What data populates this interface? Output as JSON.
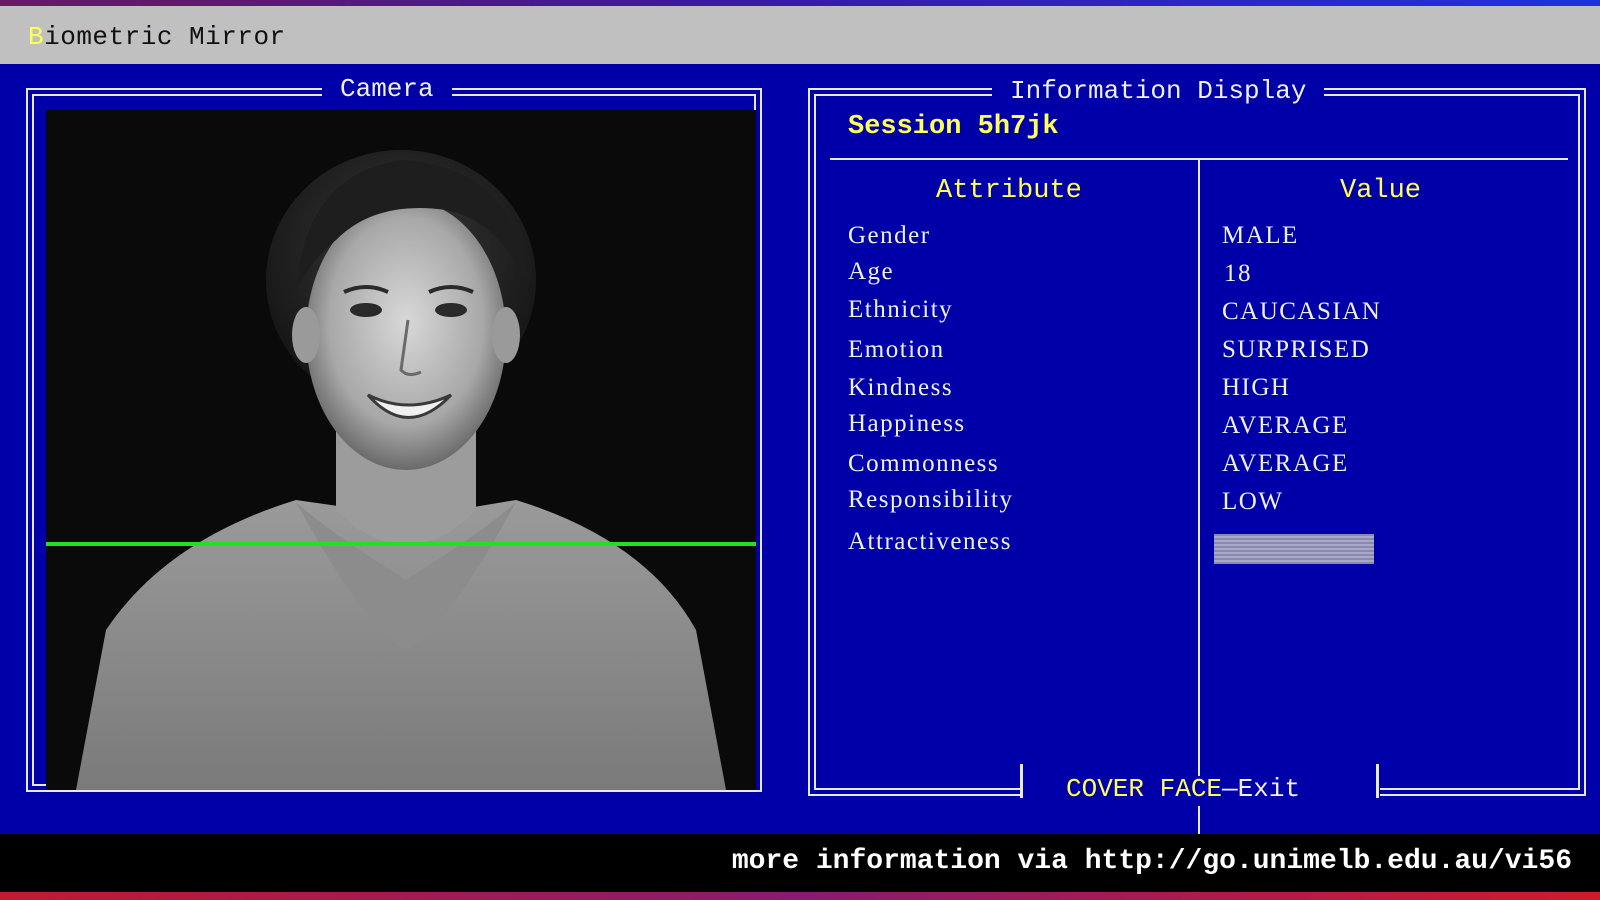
{
  "app": {
    "title_hotkey": "B",
    "title_rest": "iometric Mirror"
  },
  "camera": {
    "panel_title": "Camera"
  },
  "info": {
    "panel_title": "Information Display",
    "session": "Session 5h7jk",
    "columns": {
      "attribute": "Attribute",
      "value": "Value"
    },
    "rows": [
      {
        "attribute": "Gender",
        "value": "MALE"
      },
      {
        "attribute": "Age",
        "value": "18"
      },
      {
        "attribute": "Ethnicity",
        "value": "CAUCASIAN"
      },
      {
        "attribute": "Emotion",
        "value": "SURPRISED"
      },
      {
        "attribute": "Kindness",
        "value": "HIGH"
      },
      {
        "attribute": "Happiness",
        "value": "AVERAGE"
      },
      {
        "attribute": "Commonness",
        "value": "AVERAGE"
      },
      {
        "attribute": "Responsibility",
        "value": "LOW"
      },
      {
        "attribute": "Attractiveness",
        "value": ""
      }
    ],
    "exit_key": "COVER FACE",
    "exit_label": "—Exit"
  },
  "footer": {
    "message": "more information via http://go.unimelb.edu.au/vi56"
  },
  "colors": {
    "background": "#0000a8",
    "highlight": "#ffff55",
    "text": "#f0f0f0",
    "scanline": "#22e022"
  }
}
